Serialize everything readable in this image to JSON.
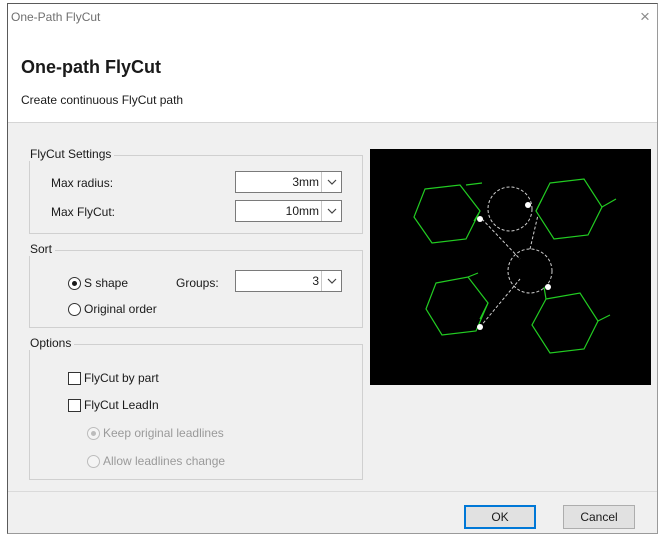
{
  "window": {
    "title": "One-Path FlyCut",
    "close_glyph": "×"
  },
  "header": {
    "heading": "One-path FlyCut",
    "subheading": "Create continuous FlyCut path"
  },
  "flycut_settings": {
    "group_label": "FlyCut Settings",
    "max_radius_label": "Max radius:",
    "max_radius_value": "3mm",
    "max_flycut_label": "Max FlyCut:",
    "max_flycut_value": "10mm"
  },
  "sort": {
    "group_label": "Sort",
    "s_shape_label": "S shape",
    "s_shape_checked": true,
    "original_order_label": "Original order",
    "original_order_checked": false,
    "groups_label": "Groups:",
    "groups_value": "3"
  },
  "options": {
    "group_label": "Options",
    "flycut_by_part_label": "FlyCut by part",
    "flycut_by_part_checked": false,
    "flycut_leadin_label": "FlyCut LeadIn",
    "flycut_leadin_checked": false,
    "keep_leadlines_label": "Keep original leadlines",
    "keep_leadlines_checked": true,
    "allow_change_label": "Allow leadlines change",
    "allow_change_checked": false
  },
  "preview": {
    "background": "#000000",
    "part_color": "#22cc22",
    "path_color": "#d0d0d0"
  },
  "footer": {
    "ok_label": "OK",
    "cancel_label": "Cancel",
    "accent": "#0078d7"
  }
}
